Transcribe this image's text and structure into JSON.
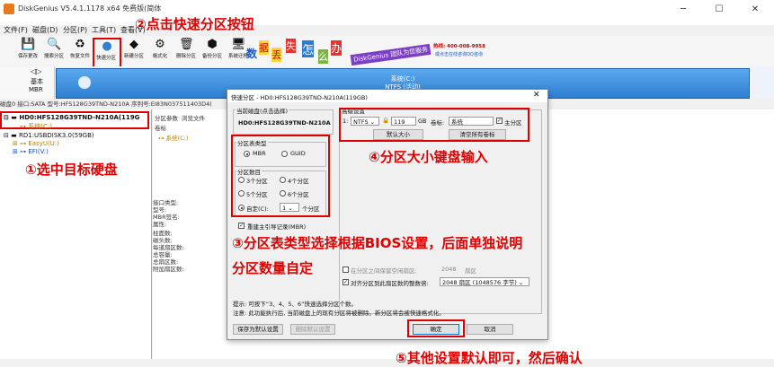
{
  "window": {
    "title": "DiskGenius V5.4.1.1178 x64 免费版(简体",
    "min": "─",
    "max": "☐",
    "close": "✕"
  },
  "menu": [
    "文件(F)",
    "磁盘(D)",
    "分区(P)",
    "工具(T)",
    "查看(V)"
  ],
  "toolbar": [
    {
      "label": "保存更改",
      "icon": "save-icon"
    },
    {
      "label": "搜索分区",
      "icon": "search-icon"
    },
    {
      "label": "恢复文件",
      "icon": "recover-icon"
    },
    {
      "label": "快速分区",
      "icon": "quick-partition-icon"
    },
    {
      "label": "新建分区",
      "icon": "new-partition-icon"
    },
    {
      "label": "格式化",
      "icon": "format-icon"
    },
    {
      "label": "删除分区",
      "icon": "delete-icon"
    },
    {
      "label": "备份分区",
      "icon": "backup-icon"
    },
    {
      "label": "系统迁移",
      "icon": "migrate-icon"
    }
  ],
  "banner": {
    "chars": [
      "数",
      "据",
      "丢",
      "失",
      "怎",
      "么",
      "办"
    ],
    "text": "DiskGenius 团队为您服务",
    "phone": "热线: 400-008-9958",
    "qq": "或点击在线咨询QQ咨询"
  },
  "disk_bar": {
    "side_label1": "基本",
    "side_label2": "MBR",
    "partition_name": "系统(C:)",
    "partition_fs": "NTFS (活动)"
  },
  "disk_info": "磁盘0 接口:SATA 型号:HFS128G39TND-N210A 序列号:EI83N037511403D4(",
  "tree": {
    "hd0": "HD0:HFS128G39TND-N210A(119G",
    "hd0_child": "系统(C:)",
    "rd1": "RD1:USBDISK3.0(59GB)",
    "rd1_child1": "EasyU(U:)",
    "rd1_child2": "EFI(V:)"
  },
  "right_panel": {
    "tabs": [
      "分区参数",
      "浏览文件"
    ],
    "vol_label": "卷标",
    "vol_item": "系统(C:)",
    "props": [
      "接口类型:",
      "型号:",
      "MBR签名:",
      "属性:",
      "",
      "柱面数:",
      "磁头数:",
      "每道扇区数:",
      "总容量:",
      "总扇区数:",
      "附加扇区数:"
    ]
  },
  "dialog": {
    "title": "快速分区 - HD0:HFS128G39TND-N210A(119GB)",
    "current_disk_group": "当前磁盘(点击选择)",
    "current_disk": "HD0:HFS128G39TND-N210A",
    "table_type_group": "分区表类型",
    "mbr": "MBR",
    "guid": "GUID",
    "count_group": "分区数目",
    "counts": [
      "3个分区",
      "4个分区",
      "5个分区",
      "6个分区"
    ],
    "custom": "自定(C):",
    "custom_value": "1",
    "custom_unit": "个分区",
    "rebuild_mbr": "重建主引导记录(MBR)",
    "advanced_group": "高级设置",
    "part_index": "1:",
    "fs": "NTFS",
    "size": "119",
    "unit": "GB",
    "label_caption": "卷标:",
    "label_value": "系统",
    "primary": "主分区",
    "default_size_btn": "默认大小",
    "clear_labels_btn": "清空所有卷标",
    "keep_space": "在分区之间保留空闲扇区:",
    "keep_value": "2048",
    "keep_unit": "扇区",
    "align": "对齐分区到此扇区数的整数倍:",
    "align_value": "2048 扇区 (1048576 字节)",
    "hint1": "提示: 可按下“3、4、5、6”快速选择分区个数。",
    "hint2": "注意: 此功能执行后, 当前磁盘上的现有分区将被删除。新分区将会被快速格式化。",
    "save_default_btn": "保存为默认设置",
    "delete_default_btn": "删除默认设置",
    "ok_btn": "确定",
    "cancel_btn": "取消"
  },
  "annotations": {
    "a1": "①选中目标硬盘",
    "a2": "②点击快速分区按钮",
    "a3_line1": "③分区表类型选择根据BIOS设置，后面单独说明",
    "a3_line2": "分区数量自定",
    "a4": "④分区大小键盘输入",
    "a5": "⑤其他设置默认即可，然后确认"
  },
  "colors": {
    "annotation_red": "#e00000",
    "partition_blue": "#3a8ddf"
  }
}
